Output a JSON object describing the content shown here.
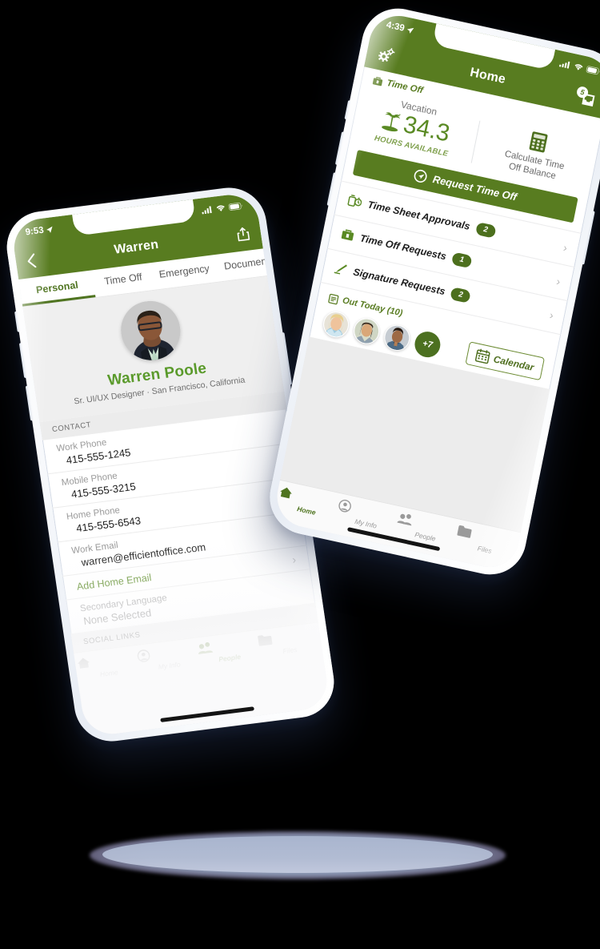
{
  "theme": {
    "brand_green": "#587C20",
    "accent_green": "#5a9a2b",
    "badge_green": "#4c6f1d",
    "muted_text": "#9b9b9b"
  },
  "phone_home": {
    "status_bar": {
      "time": "4:39",
      "location_icon": "location-arrow-icon",
      "signal_icon": "cellular-signal-icon",
      "wifi_icon": "wifi-icon",
      "battery_icon": "battery-icon"
    },
    "app_bar": {
      "title": "Home",
      "left_icon": "gears-icon",
      "right_icon": "inbox-icon",
      "right_badge": "5"
    },
    "time_off": {
      "section_label": "Time Off",
      "section_icon": "briefcase-icon",
      "vacation_label": "Vacation",
      "vacation_hours": "34.3",
      "vacation_icon": "palm-tree-icon",
      "vacation_sub": "HOURS AVAILABLE",
      "calculator_icon": "calculator-icon",
      "calculate_line1": "Calculate Time",
      "calculate_line2": "Off Balance",
      "cta_label": "Request Time Off",
      "cta_icon": "clock-send-icon"
    },
    "rows": [
      {
        "icon": "stopwatch-icon",
        "label": "Time Sheet Approvals",
        "badge": "2",
        "chevron": "chevron-right-icon"
      },
      {
        "icon": "briefcase-icon",
        "label": "Time Off Requests",
        "badge": "1",
        "chevron": "chevron-right-icon"
      },
      {
        "icon": "signature-pen-icon",
        "label": "Signature Requests",
        "badge": "2",
        "chevron": "chevron-right-icon"
      }
    ],
    "out_today": {
      "icon": "calendar-list-icon",
      "label": "Out Today (10)",
      "overflow_count": "+7",
      "calendar_button": "Calendar",
      "calendar_icon": "calendar-icon"
    },
    "tabs": [
      {
        "icon": "home-icon",
        "label": "Home",
        "active": true
      },
      {
        "icon": "person-circle-icon",
        "label": "My Info",
        "active": false
      },
      {
        "icon": "people-icon",
        "label": "People",
        "active": false
      },
      {
        "icon": "folder-icon",
        "label": "Files",
        "active": false
      }
    ]
  },
  "phone_profile": {
    "status_bar": {
      "time": "9:53",
      "location_icon": "location-arrow-icon",
      "signal_icon": "cellular-signal-icon",
      "wifi_icon": "wifi-icon",
      "battery_icon": "battery-icon"
    },
    "app_bar": {
      "title": "Warren",
      "left_icon": "back-chevron-icon",
      "right_icon": "share-icon"
    },
    "tabs": [
      {
        "label": "Personal",
        "active": true
      },
      {
        "label": "Time Off",
        "active": false
      },
      {
        "label": "Emergency",
        "active": false
      },
      {
        "label": "Documen",
        "active": false
      }
    ],
    "profile": {
      "avatar": "profile-photo",
      "name": "Warren Poole",
      "subtitle": "Sr. UI/UX Designer · San Francisco, California"
    },
    "contact_header": "CONTACT",
    "fields": [
      {
        "label": "Work Phone",
        "value": "415-555-1245"
      },
      {
        "label": "Mobile Phone",
        "value": "415-555-3215"
      },
      {
        "label": "Home Phone",
        "value": "415-555-6543"
      },
      {
        "label": "Work Email",
        "value": "warren@efficientoffice.com"
      }
    ],
    "add_home_email": "Add Home Email",
    "secondary_language": {
      "label": "Secondary Language",
      "value": "None Selected"
    },
    "social_header": "SOCIAL LINKS",
    "bottom_tabs": [
      {
        "icon": "home-icon",
        "label": "Home",
        "active": false
      },
      {
        "icon": "person-circle-icon",
        "label": "My Info",
        "active": false
      },
      {
        "icon": "people-icon",
        "label": "People",
        "active": true
      },
      {
        "icon": "folder-icon",
        "label": "Files",
        "active": false
      }
    ]
  }
}
